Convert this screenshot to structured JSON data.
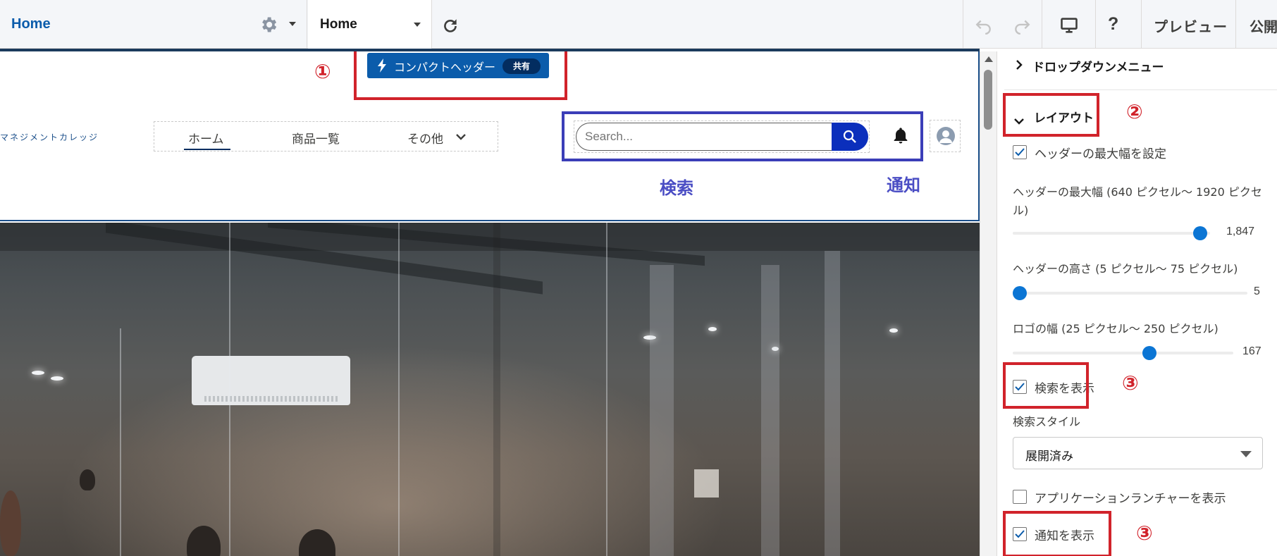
{
  "toolbar": {
    "home_label": "Home",
    "page_label": "Home",
    "preview_label": "プレビュー",
    "publish_label": "公開"
  },
  "canvas": {
    "compact_header_label": "コンパクトヘッダー",
    "shared_badge": "共有",
    "logo_text": "マネジメントカレッジ",
    "nav": {
      "home": "ホーム",
      "products": "商品一覧",
      "more": "その他"
    },
    "search_placeholder": "Search..."
  },
  "annotations": {
    "num1": "①",
    "num2": "②",
    "num3a": "③",
    "num3b": "③",
    "search_label": "検索",
    "notify_label": "通知"
  },
  "panel": {
    "dropdown_section": "ドロップダウンメニュー",
    "layout_section": "レイアウト",
    "set_max_width": "ヘッダーの最大幅を設定",
    "max_width_label": "ヘッダーの最大幅 (640 ピクセル～ 1920 ピクセル)",
    "max_width_value": "1,847",
    "max_width_level": 0.94,
    "height_label": "ヘッダーの高さ (5 ピクセル～ 75 ピクセル)",
    "height_value": "5",
    "height_level": 0.0,
    "logo_width_label": "ロゴの幅 (25 ピクセル～ 250 ピクセル)",
    "logo_width_value": "167",
    "logo_width_level": 0.63,
    "show_search": "検索を表示",
    "search_style_label": "検索スタイル",
    "search_style_value": "展開済み",
    "show_app_launcher": "アプリケーションランチャーを表示",
    "show_notifications": "通知を表示"
  },
  "colors": {
    "brand_blue": "#0b5cab",
    "annotation_red": "#d1232b",
    "annotation_blue": "#3b3eb8",
    "slider_blue": "#0b75d4"
  }
}
